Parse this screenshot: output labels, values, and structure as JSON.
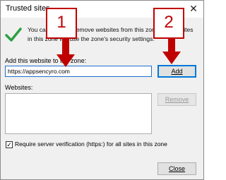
{
  "window": {
    "title": "Trusted sites",
    "close_glyph": "✕"
  },
  "info": {
    "text": "You can add and remove websites from this zone. All websites in this zone will use the zone's security settings."
  },
  "add_section": {
    "label": "Add this website to the zone:",
    "url_value": "https://appsencyro.com",
    "add_button": "Add"
  },
  "websites_section": {
    "label": "Websites:",
    "items": [],
    "remove_button": "Remove"
  },
  "verification": {
    "checked": true,
    "check_glyph": "✓",
    "label": "Require server verification (https:) for all sites in this zone"
  },
  "footer": {
    "close_button": "Close"
  },
  "annotations": {
    "step1": "1",
    "step2": "2",
    "color": "#c00000"
  }
}
